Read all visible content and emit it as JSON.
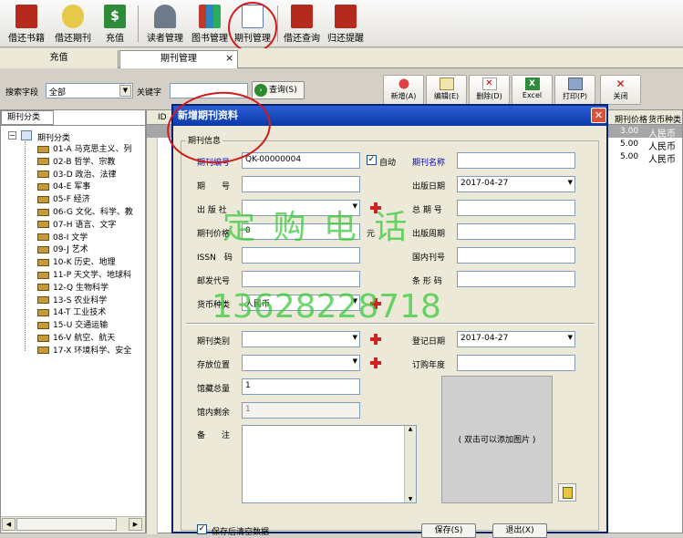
{
  "toolbar": {
    "items": [
      {
        "label": "借还书籍",
        "icon": "book-return-icon"
      },
      {
        "label": "借还期刊",
        "icon": "journal-return-icon"
      },
      {
        "label": "充值",
        "icon": "dollar-icon"
      },
      {
        "label": "读者管理",
        "icon": "readers-icon"
      },
      {
        "label": "图书管理",
        "icon": "books-icon"
      },
      {
        "label": "期刊管理",
        "icon": "journal-doc-icon"
      },
      {
        "label": "借还查询",
        "icon": "search-book-icon"
      },
      {
        "label": "归还提醒",
        "icon": "reminder-icon"
      }
    ]
  },
  "tabs": {
    "tab1": "充值",
    "tab2": "期刊管理",
    "close": "×"
  },
  "search": {
    "field_label": "搜索字段",
    "field_value": "全部",
    "keyword_label": "关键字",
    "keyword_value": "",
    "query_button": "查询(S)"
  },
  "actions": {
    "add": "新增(A)",
    "edit": "编辑(E)",
    "delete": "删除(D)",
    "excel": "Excel",
    "print": "打印(P)",
    "close": "关闭"
  },
  "tree": {
    "tab_label": "期刊分类",
    "root": "期刊分类",
    "items": [
      "01-A  马克思主义、列",
      "02-B  哲学、宗教",
      "03-D  政治、法律",
      "04-E  军事",
      "05-F  经济",
      "06-G  文化、科学、教",
      "07-H  语言、文字",
      "08-I  文学",
      "09-J  艺术",
      "10-K  历史、地理",
      "11-P  天文学、地球科",
      "12-Q  生物科学",
      "13-S  农业科学",
      "14-T  工业技术",
      "15-U  交通运输",
      "16-V  航空、航天",
      "17-X  环境科学、安全"
    ]
  },
  "grid": {
    "col_id": "ID",
    "col_price": "期刊价格",
    "col_currency": "货币种类",
    "rows": [
      {
        "price": "3.00",
        "currency": "人民币"
      },
      {
        "price": "5.00",
        "currency": "人民币"
      },
      {
        "price": "5.00",
        "currency": "人民币"
      }
    ]
  },
  "dialog": {
    "title": "新增期刊资料",
    "group": "期刊信息",
    "code_label": "期刊编号",
    "code_value": "QK-00000004",
    "auto_label": "自动",
    "name_label": "期刊名称",
    "issue_label": "期　　号",
    "pubdate_label": "出版日期",
    "pubdate_value": "2017-04-27",
    "publisher_label": "出 版 社",
    "total_label": "总 期 号",
    "price_label": "期刊价格",
    "price_value": "0",
    "price_unit": "元",
    "cycle_label": "出版周期",
    "issn_label": "ISSN　码",
    "domestic_label": "国内刊号",
    "postal_label": "邮发代号",
    "barcode_label": "条 形 码",
    "currency_label": "货币种类",
    "currency_value": "人民币",
    "category_label": "期刊类别",
    "regdate_label": "登记日期",
    "regdate_value": "2017-04-27",
    "location_label": "存放位置",
    "subyear_label": "订购年度",
    "stock_label": "馆藏总量",
    "stock_value": "1",
    "remain_label": "馆内剩余",
    "remain_value": "1",
    "remark_label": "备　　注",
    "image_hint": "( 双击可以添加图片 )",
    "clear_label": "保存后清空数据",
    "save_button": "保存(S)",
    "exit_button": "退出(X)"
  },
  "watermark": {
    "line1": "定 购 电 话",
    "line2": "13628228718"
  },
  "colors": {
    "accent": "#0a246a",
    "title_bar": "#0b3aa8",
    "highlight_circle": "#d21b1b",
    "plus": "#d02020"
  }
}
